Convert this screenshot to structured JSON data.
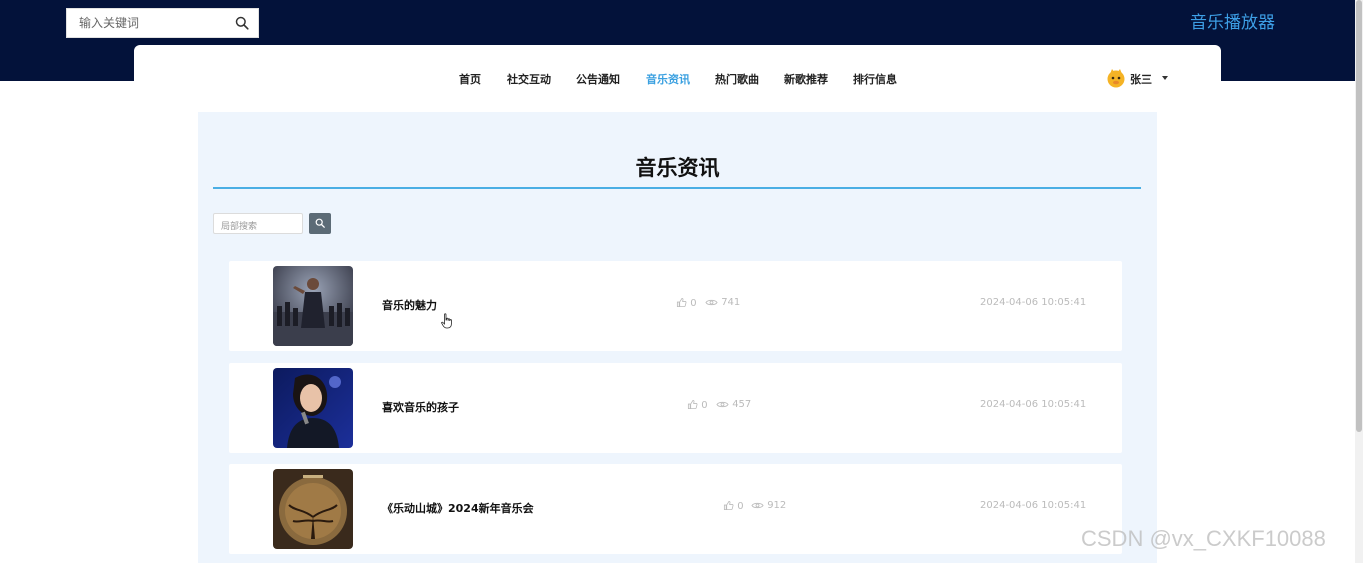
{
  "header": {
    "search_placeholder": "输入关键词",
    "app_title": "音乐播放器"
  },
  "nav": {
    "items": [
      {
        "label": "首页",
        "active": false
      },
      {
        "label": "社交互动",
        "active": false
      },
      {
        "label": "公告通知",
        "active": false
      },
      {
        "label": "音乐资讯",
        "active": true
      },
      {
        "label": "热门歌曲",
        "active": false
      },
      {
        "label": "新歌推荐",
        "active": false
      },
      {
        "label": "排行信息",
        "active": false
      }
    ],
    "user": {
      "name": "张三"
    }
  },
  "main": {
    "title": "音乐资讯",
    "search_placeholder": "局部搜索",
    "news": [
      {
        "title": "音乐的魅力",
        "likes": "0",
        "views": "741",
        "date": "2024-04-06 10:05:41"
      },
      {
        "title": "喜欢音乐的孩子",
        "likes": "0",
        "views": "457",
        "date": "2024-04-06 10:05:41"
      },
      {
        "title": "《乐动山城》2024新年音乐会",
        "likes": "0",
        "views": "912",
        "date": "2024-04-06 10:05:41"
      }
    ]
  },
  "watermark": "CSDN @vx_CXKF10088",
  "colors": {
    "header_bg": "#03123a",
    "accent": "#3aa0e0",
    "content_bg": "#eef5fd",
    "title_line": "#4aaee4"
  }
}
